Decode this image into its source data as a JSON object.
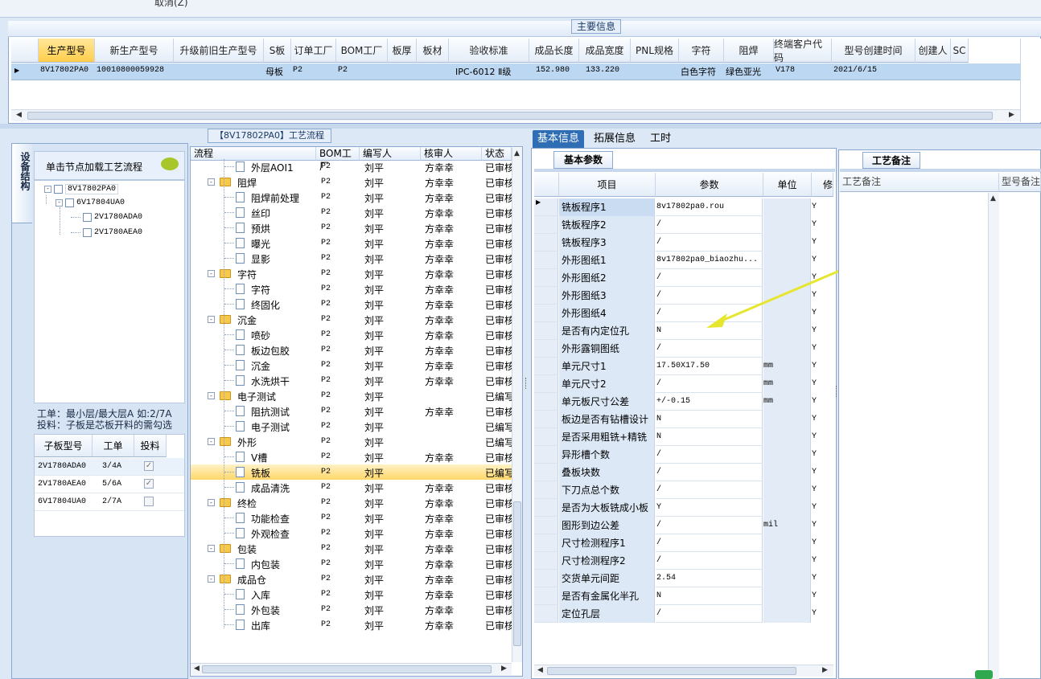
{
  "top": {
    "partial_text": "取消(Z)"
  },
  "main_info": {
    "title": "主要信息",
    "columns": [
      "生产型号",
      "新生产型号",
      "升级前旧生产型号",
      "S板",
      "订单工厂",
      "BOM工厂",
      "板厚",
      "板材",
      "验收标准",
      "成品长度",
      "成品宽度",
      "PNL规格",
      "字符",
      "阻焊",
      "终端客户代码",
      "型号创建时间",
      "创建人",
      "SC"
    ],
    "row": [
      "8V17802PA0",
      "10010800059928",
      "",
      "母板",
      "P2",
      "P2",
      "",
      "",
      "IPC-6012 Ⅱ级",
      "152.980",
      "133.220",
      "",
      "白色字符",
      "绿色亚光",
      "V178",
      "2021/6/15",
      "",
      ""
    ]
  },
  "left": {
    "vertical_tab": "设备结构",
    "tree_header": "单击节点加载工艺流程",
    "tree": [
      {
        "label": "8V17802PA0",
        "toggle": "-"
      },
      {
        "label": "6V17804UA0",
        "toggle": "-"
      },
      {
        "label": "2V1780ADA0",
        "toggle": ""
      },
      {
        "label": "2V1780AEA0",
        "toggle": ""
      }
    ],
    "note_line1": "工单：最小层/最大层A 如:2/7A",
    "note_line2": "投料：子板是芯板开料的需勾选",
    "sub_columns": [
      "子板型号",
      "工单",
      "投料"
    ],
    "sub_rows": [
      {
        "model": "2V1780ADA0",
        "order": "3/4A",
        "checked": true
      },
      {
        "model": "2V1780AEA0",
        "order": "5/6A",
        "checked": true
      },
      {
        "model": "6V17804UA0",
        "order": "2/7A",
        "checked": false
      }
    ]
  },
  "process": {
    "title": "【8V17802PA0】工艺流程",
    "columns": [
      "流程",
      "BOM工厂",
      "编写人",
      "核审人",
      "状态"
    ],
    "rows": [
      {
        "name": "外层AOI1",
        "type": "doc",
        "bom": "P2",
        "writer": "刘平",
        "reviewer": "方幸幸",
        "status": "已审核"
      },
      {
        "name": "阻焊",
        "type": "folder",
        "bom": "P2",
        "writer": "刘平",
        "reviewer": "方幸幸",
        "status": "已审核"
      },
      {
        "name": "阻焊前处理",
        "type": "doc",
        "bom": "P2",
        "writer": "刘平",
        "reviewer": "方幸幸",
        "status": "已审核"
      },
      {
        "name": "丝印",
        "type": "doc",
        "bom": "P2",
        "writer": "刘平",
        "reviewer": "方幸幸",
        "status": "已审核"
      },
      {
        "name": "预烘",
        "type": "doc",
        "bom": "P2",
        "writer": "刘平",
        "reviewer": "方幸幸",
        "status": "已审核"
      },
      {
        "name": "曝光",
        "type": "doc",
        "bom": "P2",
        "writer": "刘平",
        "reviewer": "方幸幸",
        "status": "已审核"
      },
      {
        "name": "显影",
        "type": "doc",
        "bom": "P2",
        "writer": "刘平",
        "reviewer": "方幸幸",
        "status": "已审核"
      },
      {
        "name": "字符",
        "type": "folder",
        "bom": "P2",
        "writer": "刘平",
        "reviewer": "方幸幸",
        "status": "已审核"
      },
      {
        "name": "字符",
        "type": "doc",
        "bom": "P2",
        "writer": "刘平",
        "reviewer": "方幸幸",
        "status": "已审核"
      },
      {
        "name": "终固化",
        "type": "doc",
        "bom": "P2",
        "writer": "刘平",
        "reviewer": "方幸幸",
        "status": "已审核"
      },
      {
        "name": "沉金",
        "type": "folder",
        "bom": "P2",
        "writer": "刘平",
        "reviewer": "方幸幸",
        "status": "已审核"
      },
      {
        "name": "喷砂",
        "type": "doc",
        "bom": "P2",
        "writer": "刘平",
        "reviewer": "方幸幸",
        "status": "已审核"
      },
      {
        "name": "板边包胶",
        "type": "doc",
        "bom": "P2",
        "writer": "刘平",
        "reviewer": "方幸幸",
        "status": "已审核"
      },
      {
        "name": "沉金",
        "type": "doc",
        "bom": "P2",
        "writer": "刘平",
        "reviewer": "方幸幸",
        "status": "已审核"
      },
      {
        "name": "水洗烘干",
        "type": "doc",
        "bom": "P2",
        "writer": "刘平",
        "reviewer": "方幸幸",
        "status": "已审核"
      },
      {
        "name": "电子测试",
        "type": "folder",
        "bom": "P2",
        "writer": "刘平",
        "reviewer": "",
        "status": "已编写"
      },
      {
        "name": "阻抗测试",
        "type": "doc",
        "bom": "P2",
        "writer": "刘平",
        "reviewer": "方幸幸",
        "status": "已审核"
      },
      {
        "name": "电子测试",
        "type": "doc",
        "bom": "P2",
        "writer": "刘平",
        "reviewer": "",
        "status": "已编写"
      },
      {
        "name": "外形",
        "type": "folder",
        "bom": "P2",
        "writer": "刘平",
        "reviewer": "",
        "status": "已编写"
      },
      {
        "name": "V槽",
        "type": "doc",
        "bom": "P2",
        "writer": "刘平",
        "reviewer": "方幸幸",
        "status": "已审核"
      },
      {
        "name": "铣板",
        "type": "doc",
        "bom": "P2",
        "writer": "刘平",
        "reviewer": "",
        "status": "已编写",
        "selected": true
      },
      {
        "name": "成品清洗",
        "type": "doc",
        "bom": "P2",
        "writer": "刘平",
        "reviewer": "方幸幸",
        "status": "已审核"
      },
      {
        "name": "终检",
        "type": "folder",
        "bom": "P2",
        "writer": "刘平",
        "reviewer": "方幸幸",
        "status": "已审核"
      },
      {
        "name": "功能检查",
        "type": "doc",
        "bom": "P2",
        "writer": "刘平",
        "reviewer": "方幸幸",
        "status": "已审核"
      },
      {
        "name": "外观检查",
        "type": "doc",
        "bom": "P2",
        "writer": "刘平",
        "reviewer": "方幸幸",
        "status": "已审核"
      },
      {
        "name": "包装",
        "type": "folder",
        "bom": "P2",
        "writer": "刘平",
        "reviewer": "方幸幸",
        "status": "已审核"
      },
      {
        "name": "内包装",
        "type": "doc",
        "bom": "P2",
        "writer": "刘平",
        "reviewer": "方幸幸",
        "status": "已审核"
      },
      {
        "name": "成品仓",
        "type": "folder",
        "bom": "P2",
        "writer": "刘平",
        "reviewer": "方幸幸",
        "status": "已审核"
      },
      {
        "name": "入库",
        "type": "doc",
        "bom": "P2",
        "writer": "刘平",
        "reviewer": "方幸幸",
        "status": "已审核"
      },
      {
        "name": "外包装",
        "type": "doc",
        "bom": "P2",
        "writer": "刘平",
        "reviewer": "方幸幸",
        "status": "已审核"
      },
      {
        "name": "出库",
        "type": "doc",
        "bom": "P2",
        "writer": "刘平",
        "reviewer": "方幸幸",
        "status": "已审核"
      }
    ]
  },
  "right": {
    "tabs": [
      "基本信息",
      "拓展信息",
      "工时"
    ],
    "sub_tab": "基本参数",
    "columns": [
      "项目",
      "参数",
      "单位",
      "修"
    ],
    "params": [
      {
        "item": "铣板程序1",
        "value": "8v17802pa0.rou",
        "unit": "",
        "mod": "Y"
      },
      {
        "item": "铣板程序2",
        "value": "/",
        "unit": "",
        "mod": "Y"
      },
      {
        "item": "铣板程序3",
        "value": "/",
        "unit": "",
        "mod": "Y"
      },
      {
        "item": "外形图纸1",
        "value": "8v17802pa0_biaozhu...",
        "unit": "",
        "mod": "Y"
      },
      {
        "item": "外形图纸2",
        "value": "/",
        "unit": "",
        "mod": "Y"
      },
      {
        "item": "外形图纸3",
        "value": "/",
        "unit": "",
        "mod": "Y"
      },
      {
        "item": "外形图纸4",
        "value": "/",
        "unit": "",
        "mod": "Y"
      },
      {
        "item": "是否有内定位孔",
        "value": "N",
        "unit": "",
        "mod": "Y"
      },
      {
        "item": "外形露铜图纸",
        "value": "/",
        "unit": "",
        "mod": "Y"
      },
      {
        "item": "单元尺寸1",
        "value": "17.50X17.50",
        "unit": "mm",
        "mod": "Y"
      },
      {
        "item": "单元尺寸2",
        "value": "/",
        "unit": "mm",
        "mod": "Y"
      },
      {
        "item": "单元板尺寸公差",
        "value": "+/-0.15",
        "unit": "mm",
        "mod": "Y"
      },
      {
        "item": "板边是否有钻槽设计",
        "value": "N",
        "unit": "",
        "mod": "Y"
      },
      {
        "item": "是否采用粗铣+精铣",
        "value": "N",
        "unit": "",
        "mod": "Y"
      },
      {
        "item": "异形槽个数",
        "value": "/",
        "unit": "",
        "mod": "Y"
      },
      {
        "item": "叠板块数",
        "value": "/",
        "unit": "",
        "mod": "Y"
      },
      {
        "item": "下刀点总个数",
        "value": "/",
        "unit": "",
        "mod": "Y"
      },
      {
        "item": "是否为大板铣成小板",
        "value": "Y",
        "unit": "",
        "mod": "Y"
      },
      {
        "item": "图形到边公差",
        "value": "/",
        "unit": "mil",
        "mod": "Y"
      },
      {
        "item": "尺寸检测程序1",
        "value": "/",
        "unit": "",
        "mod": "Y"
      },
      {
        "item": "尺寸检测程序2",
        "value": "/",
        "unit": "",
        "mod": "Y"
      },
      {
        "item": "交货单元间距",
        "value": "2.54",
        "unit": "",
        "mod": "Y"
      },
      {
        "item": "是否有金属化半孔",
        "value": "N",
        "unit": "",
        "mod": "Y"
      },
      {
        "item": "定位孔层",
        "value": "/",
        "unit": "",
        "mod": "Y"
      }
    ]
  },
  "remarks": {
    "tab": "工艺备注",
    "col1": "工艺备注",
    "col2": "型号备注"
  },
  "colors": {
    "accent": "#2f6db5",
    "selection": "#ffd769",
    "annotation_arrow": "#e6e62e"
  }
}
